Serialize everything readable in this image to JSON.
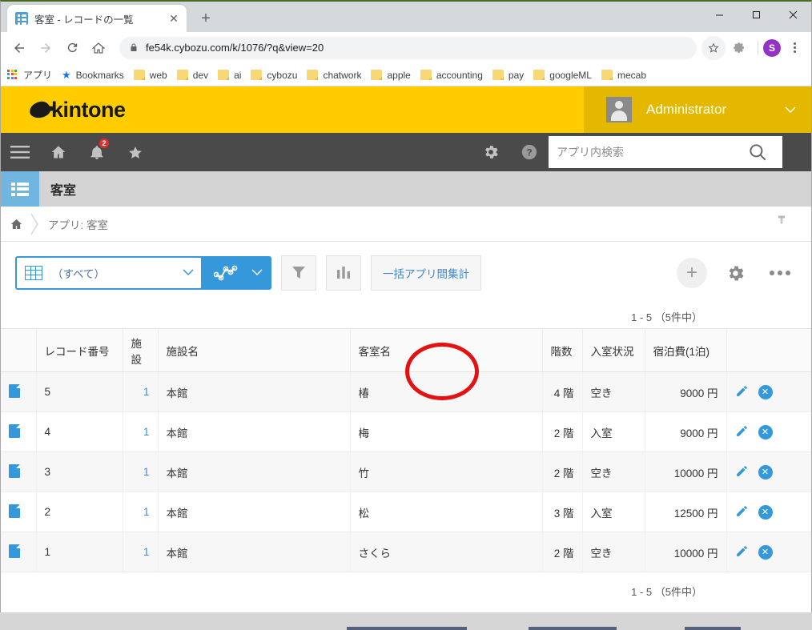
{
  "browser": {
    "tab": {
      "title": "客室 - レコードの一覧",
      "favicon": "kintone-app-icon",
      "close_label": "✕"
    },
    "new_tab_label": "+",
    "window_controls": {
      "minimize": "minimize-icon",
      "maximize": "maximize-icon",
      "close": "close-icon"
    },
    "nav": {
      "back": "back-arrow-icon",
      "forward": "forward-arrow-icon",
      "reload": "reload-icon",
      "home": "home-icon"
    },
    "omnibox": {
      "url": "fe54k.cybozu.com/k/1076/?q&view=20",
      "lock": "lock-icon",
      "star": "star-icon",
      "extension": "extension-gear-icon"
    },
    "profile": {
      "initial": "S",
      "color": "#9334c6"
    },
    "menu": "kebab-menu-icon",
    "bookmarks": [
      {
        "label": "アプリ",
        "icon": "apps-grid-icon"
      },
      {
        "label": "Bookmarks",
        "icon": "star-icon"
      },
      {
        "label": "web",
        "icon": "folder-icon"
      },
      {
        "label": "dev",
        "icon": "folder-icon"
      },
      {
        "label": "ai",
        "icon": "folder-icon"
      },
      {
        "label": "cybozu",
        "icon": "folder-icon"
      },
      {
        "label": "chatwork",
        "icon": "folder-icon"
      },
      {
        "label": "apple",
        "icon": "folder-icon"
      },
      {
        "label": "accounting",
        "icon": "folder-icon"
      },
      {
        "label": "pay",
        "icon": "folder-icon"
      },
      {
        "label": "googleML",
        "icon": "folder-icon"
      },
      {
        "label": "mecab",
        "icon": "folder-icon"
      }
    ]
  },
  "kintone": {
    "brand": "kintone",
    "brand_color": "#ffcc00",
    "user": {
      "name": "Administrator",
      "caret": "⌄",
      "avatar": "user-avatar-icon"
    },
    "navbar": {
      "menu": "hamburger-menu-icon",
      "home": "home-icon",
      "notifications": {
        "icon": "bell-icon",
        "count": "2"
      },
      "favorites": "star-icon",
      "settings": "gear-icon",
      "help": "help-icon",
      "search_placeholder": "アプリ内検索",
      "search_value": "",
      "search_button": "search-icon"
    },
    "app": {
      "title": "客室",
      "icon": "app-list-icon"
    },
    "breadcrumb": {
      "home": "home-icon",
      "text": "アプリ: 客室",
      "pin": "pin-icon"
    },
    "toolbar": {
      "view_label": "（すべて）",
      "view_icon": "table-grid-icon",
      "chart_icon": "graph-icon",
      "filter_button": "filter-icon",
      "chart_button": "bar-chart-icon",
      "aggregate_button": "一括アプリ間集計",
      "add_button": "+",
      "settings_button": "gear-icon",
      "more_button": "more-dots-icon"
    },
    "record_count_top": "1 - 5 （5件中）",
    "record_count_bottom": "1 - 5 （5件中）",
    "table": {
      "headers": [
        "",
        "レコード番号",
        "施設",
        "施設名",
        "客室名",
        "階数",
        "入室状況",
        "宿泊費(1泊)",
        ""
      ],
      "rows": [
        {
          "record_no": "5",
          "facility": "1",
          "facility_name": "本館",
          "room_name": "椿",
          "floor": "4 階",
          "status": "空き",
          "price": "9000 円",
          "edit": "pencil-icon",
          "delete": "delete-icon"
        },
        {
          "record_no": "4",
          "facility": "1",
          "facility_name": "本館",
          "room_name": "梅",
          "floor": "2 階",
          "status": "入室",
          "price": "9000 円",
          "edit": "pencil-icon",
          "delete": "delete-icon"
        },
        {
          "record_no": "3",
          "facility": "1",
          "facility_name": "本館",
          "room_name": "竹",
          "floor": "2 階",
          "status": "空き",
          "price": "10000 円",
          "edit": "pencil-icon",
          "delete": "delete-icon"
        },
        {
          "record_no": "2",
          "facility": "1",
          "facility_name": "本館",
          "room_name": "松",
          "floor": "3 階",
          "status": "入室",
          "price": "12500 円",
          "edit": "pencil-icon",
          "delete": "delete-icon"
        },
        {
          "record_no": "1",
          "facility": "1",
          "facility_name": "本館",
          "room_name": "さくら",
          "floor": "2 階",
          "status": "空き",
          "price": "10000 円",
          "edit": "pencil-icon",
          "delete": "delete-icon"
        }
      ]
    }
  },
  "annotation": {
    "shape": "red-ellipse-highlight",
    "color": "#e51010",
    "target": "一括アプリ間集計"
  }
}
